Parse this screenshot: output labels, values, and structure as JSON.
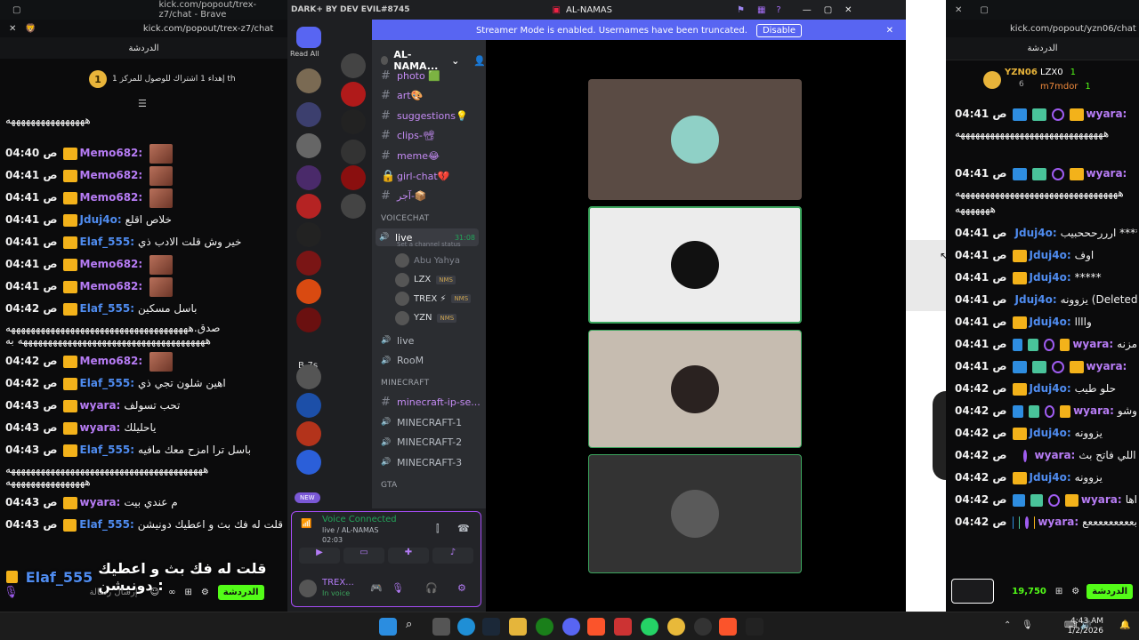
{
  "left_window": {
    "title": "kick.com/popout/trex-z7/chat - Brave",
    "address": "kick.com/popout/trex-z7/chat",
    "header": "الدردشة",
    "goal_count": "1",
    "goal_text": "إهداء 1 اشتراك للوصول للمركز 1 th",
    "messages": [
      {
        "time": "",
        "user": "",
        "text": "ههههههههههههههههه",
        "color": "#f2f2f2"
      },
      {
        "time": "04:40 ص",
        "user": "Memo682:",
        "text": "",
        "color": "#b77cf5"
      },
      {
        "time": "04:41 ص",
        "user": "Memo682:",
        "text": "",
        "color": "#b77cf5"
      },
      {
        "time": "04:41 ص",
        "user": "Memo682:",
        "text": "",
        "color": "#b77cf5"
      },
      {
        "time": "04:41 ص",
        "user": "Jduj4o:",
        "text": "خلاص اقلع",
        "color": "#4f8cf0"
      },
      {
        "time": "04:41 ص",
        "user": "Elaf_555:",
        "text": "خير وش قلت الادب ذي",
        "color": "#4f8cf0"
      },
      {
        "time": "04:41 ص",
        "user": "Memo682:",
        "text": "",
        "color": "#b77cf5"
      },
      {
        "time": "04:41 ص",
        "user": "Memo682:",
        "text": "",
        "color": "#b77cf5"
      },
      {
        "time": "04:42 ص",
        "user": "Elaf_555:",
        "text": "باسل مسكين",
        "color": "#4f8cf0"
      },
      {
        "time": "",
        "user": "",
        "text": "صدق.هههههههههههههههههههههههههههههههههههههه ههههههههههههههههههههههههههههههههههههههه به",
        "color": "#f2f2f2"
      },
      {
        "time": "04:42 ص",
        "user": "Memo682:",
        "text": "",
        "color": "#b77cf5"
      },
      {
        "time": "04:42 ص",
        "user": "Elaf_555:",
        "text": "اهين شلون تجي ذي",
        "color": "#4f8cf0"
      },
      {
        "time": "04:43 ص",
        "user": "wyara:",
        "text": "تحب تسولف",
        "color": "#b77cf5"
      },
      {
        "time": "04:43 ص",
        "user": "wyara:",
        "text": "ياحليلك",
        "color": "#b77cf5"
      },
      {
        "time": "04:43 ص",
        "user": "Elaf_555:",
        "text": "باسل ترا امزح معك مافيه",
        "color": "#4f8cf0"
      },
      {
        "time": "",
        "user": "",
        "text": "ههههههههههههههههههههههههههههههههههههههههه ههههههههههههههههه",
        "color": "#f2f2f2"
      },
      {
        "time": "04:43 ص",
        "user": "wyara:",
        "text": "م عندي بيت",
        "color": "#b77cf5"
      },
      {
        "time": "04:43 ص",
        "user": "Elaf_555:",
        "text": "قلت له فك بث و اعطيك دونيشن",
        "color": "#4f8cf0"
      }
    ],
    "caption_user": "Elaf_555",
    "caption_text": "قلت له فك بث و اعطيك دونيشن :",
    "input_placeholder": "إرسال رسالة",
    "send_label": "الدردشة"
  },
  "discord": {
    "app_title": "DARK+ BY DEV EVIL#8745",
    "window_title": "AL-NAMAS",
    "banner_text": "Streamer Mode is enabled. Usernames have been truncated.",
    "disable_label": "Disable",
    "read_all": "Read All",
    "server_name": "AL-NAMA...",
    "new_badge": "NEW",
    "server_b7s": "B-7s",
    "channels": [
      {
        "name": "photo 🟩",
        "icon": "#"
      },
      {
        "name": "art🎨",
        "icon": "#"
      },
      {
        "name": "suggestions💡",
        "icon": "#"
      },
      {
        "name": "clips-📽",
        "icon": "#"
      },
      {
        "name": "meme😂",
        "icon": "#"
      },
      {
        "name": "girl-chat💔",
        "icon": "🔒"
      },
      {
        "name": "آجر-📦",
        "icon": "#"
      }
    ],
    "voicechat_category": "VOICECHAT",
    "live_channel": "live",
    "live_timer": "31:08",
    "channel_status": "Set a channel status",
    "voice_members": [
      {
        "name": "Abu Yahya",
        "tag": ""
      },
      {
        "name": "LZX",
        "tag": "NMS"
      },
      {
        "name": "TREX ⚡",
        "tag": "NMS"
      },
      {
        "name": "YZN",
        "tag": "NMS"
      }
    ],
    "voice_channels": [
      "live",
      "RooM"
    ],
    "minecraft_category": "MINECRAFT",
    "minecraft_channels": [
      {
        "name": "minecraft-ip-se...",
        "icon": "#"
      },
      {
        "name": "MINECRAFT-1",
        "icon": "🔊"
      },
      {
        "name": "MINECRAFT-2",
        "icon": "🔊"
      },
      {
        "name": "MINECRAFT-3",
        "icon": "🔊"
      }
    ],
    "gta_category": "GTA",
    "voice_connected": "Voice Connected",
    "voice_location": "live / AL-NAMAS",
    "voice_time": "02:03",
    "self_name": "TREX...",
    "self_status": "In voice"
  },
  "right_window": {
    "address": "kick.com/popout/yzn06/chat",
    "header": "الدردشة",
    "channel_name": "YZN06",
    "viewer_count": "6",
    "top_users": [
      {
        "name": "LZX0",
        "count": "1"
      },
      {
        "name": "m7mdor",
        "count": "1"
      }
    ],
    "messages": [
      {
        "time": "04:41 ص",
        "user": "wyara:",
        "text": "",
        "color": "#b77cf5"
      },
      {
        "time": "",
        "user": "",
        "text": "ههههههههههههههههههههههههههههههه",
        "color": "#f2f2f2"
      },
      {
        "time": "04:41 ص",
        "user": "wyara:",
        "text": "",
        "color": "#b77cf5"
      },
      {
        "time": "",
        "user": "",
        "text": "هههههههههههههههههههههههههههههههههه هههههههه",
        "color": "#f2f2f2"
      },
      {
        "time": "04:41 ص",
        "user": "Jduj4o:",
        "text": "ارررحححبيب *****",
        "color": "#4f8cf0"
      },
      {
        "time": "04:41 ص",
        "user": "Jduj4o:",
        "text": "اوف",
        "color": "#4f8cf0"
      },
      {
        "time": "04:41 ص",
        "user": "Jduj4o:",
        "text": "*****",
        "color": "#4f8cf0"
      },
      {
        "time": "04:41 ص",
        "user": "Jduj4o:",
        "text": "يزوونه (Deleted)",
        "color": "#4f8cf0"
      },
      {
        "time": "04:41 ص",
        "user": "Jduj4o:",
        "text": "واااا",
        "color": "#4f8cf0"
      },
      {
        "time": "04:41 ص",
        "user": "wyara:",
        "text": "مزنه",
        "color": "#b77cf5"
      },
      {
        "time": "04:41 ص",
        "user": "wyara:",
        "text": "",
        "color": "#b77cf5"
      },
      {
        "time": "04:42 ص",
        "user": "Jduj4o:",
        "text": "حلو طيب",
        "color": "#4f8cf0"
      },
      {
        "time": "04:42 ص",
        "user": "wyara:",
        "text": "وشو",
        "color": "#b77cf5"
      },
      {
        "time": "04:42 ص",
        "user": "Jduj4o:",
        "text": "يزوونه",
        "color": "#4f8cf0"
      },
      {
        "time": "04:42 ص",
        "user": "wyara:",
        "text": "من اللي فاتح بث",
        "color": "#b77cf5"
      },
      {
        "time": "04:42 ص",
        "user": "Jduj4o:",
        "text": "يزوونه",
        "color": "#4f8cf0"
      },
      {
        "time": "04:42 ص",
        "user": "wyara:",
        "text": "اها",
        "color": "#b77cf5"
      },
      {
        "time": "04:42 ص",
        "user": "wyara:",
        "text": "بعععععععععع",
        "color": "#b77cf5"
      }
    ],
    "points": "19,750",
    "send_label": "الدردشة"
  },
  "taskbar": {
    "time": "4:43 AM",
    "date": "1/2/2026"
  }
}
